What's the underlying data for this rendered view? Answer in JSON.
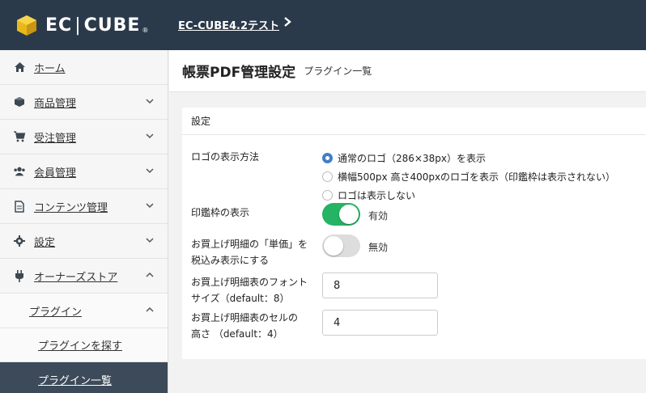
{
  "header": {
    "logo_text": "EC",
    "logo_text2": "CUBE",
    "logo_reg": "®",
    "shop_name": "EC-CUBE4.2テスト",
    "shop_icon": "chevron-right-icon",
    "bg_color": "#2b3a4b"
  },
  "sidebar": {
    "items": [
      {
        "label": "ホーム",
        "icon": "home-icon"
      },
      {
        "label": "商品管理",
        "icon": "cube-icon"
      },
      {
        "label": "受注管理",
        "icon": "cart-icon"
      },
      {
        "label": "会員管理",
        "icon": "users-icon"
      },
      {
        "label": "コンテンツ管理",
        "icon": "file-icon"
      },
      {
        "label": "設定",
        "icon": "gear-icon"
      },
      {
        "label": "オーナーズストア",
        "icon": "plug-icon"
      }
    ],
    "sub_plugin": "プラグイン",
    "sub_find": "プラグインを探す",
    "sub_list": "プラグイン一覧",
    "active_color": "#3c4a5a"
  },
  "main": {
    "title": "帳票PDF管理設定",
    "subtitle": "プラグイン一覧",
    "card_title": "設定",
    "logo_label": "ロゴの表示方法",
    "logo_options": [
      "通常のロゴ（286×38px）を表示",
      "横幅500px 高さ400pxのロゴを表示（印鑑枠は表示されない）",
      "ロゴは表示しない"
    ],
    "logo_selected_index": 0,
    "seal_label": "印鑑枠の表示",
    "seal_state": "有効",
    "seal_on": true,
    "tax_label_1": "お買上げ明細の「単価」を",
    "tax_label_2": "税込み表示にする",
    "tax_state": "無効",
    "tax_on": false,
    "font_label_1": "お買上げ明細表のフォント",
    "font_label_2": "サイズ（default：8）",
    "font_value": "8",
    "cell_label_1": "お買上げ明細表のセルの",
    "cell_label_2": "高さ （default：4）",
    "cell_value": "4",
    "accent_color": "#437ec4",
    "toggle_on_color": "#25b364"
  }
}
